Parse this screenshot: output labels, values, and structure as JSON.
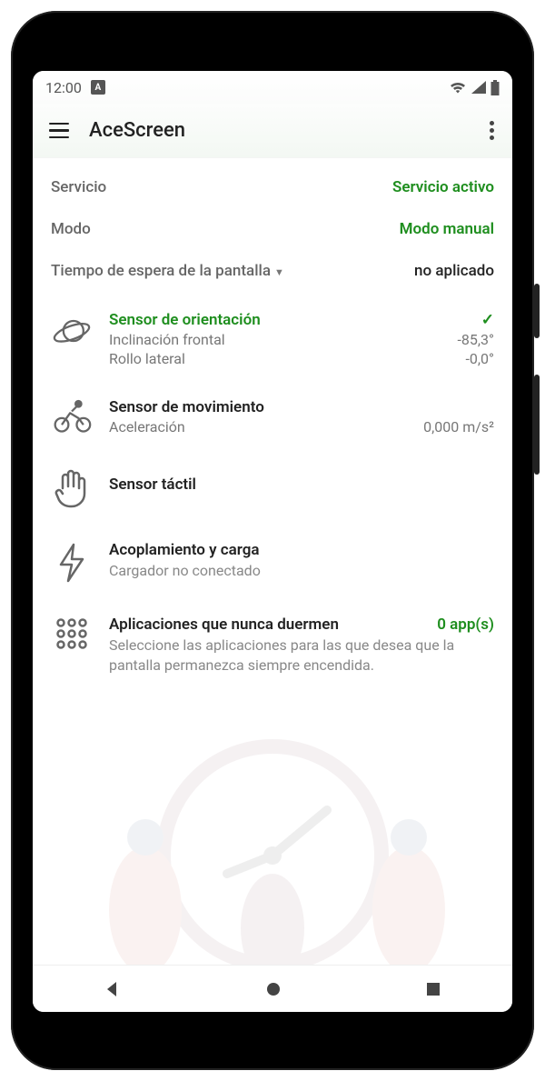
{
  "status_bar": {
    "time": "12:00"
  },
  "app_bar": {
    "title": "AceScreen"
  },
  "status": {
    "service_label": "Servicio",
    "service_value": "Servicio activo",
    "mode_label": "Modo",
    "mode_value": "Modo manual",
    "timeout_label": "Tiempo de espera de la pantalla",
    "timeout_value": "no aplicado"
  },
  "sensors": {
    "orientation": {
      "title": "Sensor de orientación",
      "check": "✓",
      "frontal_label": "Inclinación frontal",
      "frontal_value": "-85,3°",
      "roll_label": "Rollo lateral",
      "roll_value": "-0,0°"
    },
    "motion": {
      "title": "Sensor de movimiento",
      "accel_label": "Aceleración",
      "accel_value": "0,000 m/s²"
    },
    "touch": {
      "title": "Sensor táctil"
    },
    "charging": {
      "title": "Acoplamiento y carga",
      "subtitle": "Cargador no conectado"
    },
    "apps": {
      "title": "Aplicaciones que nunca duermen",
      "count": "0 app(s)",
      "description": "Seleccione las aplicaciones para las que desea que la pantalla permanezca siempre encendida."
    }
  }
}
